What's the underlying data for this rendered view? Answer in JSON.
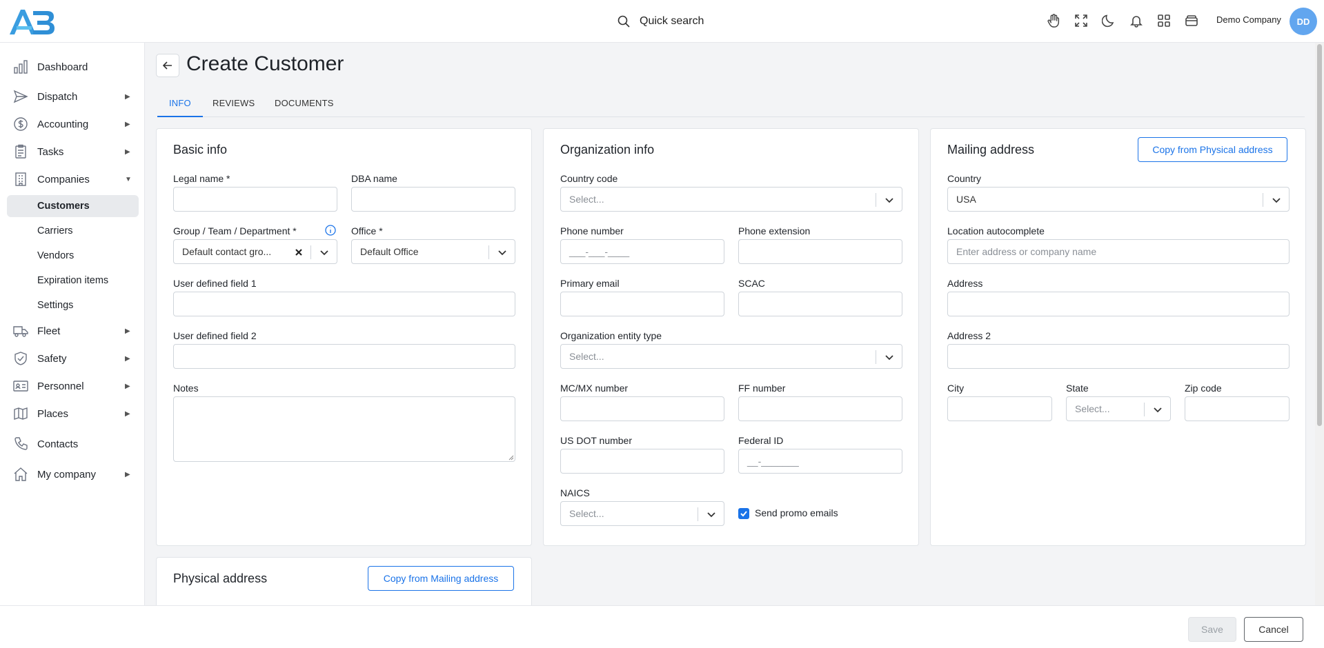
{
  "header": {
    "logo_text": "AB",
    "quick_search": "Quick search",
    "company_name": "Demo Company",
    "avatar_initials": "DD",
    "icons": [
      "hand-icon",
      "fullscreen-icon",
      "moon-icon",
      "bell-icon",
      "apps-grid-icon",
      "wallet-icon"
    ]
  },
  "sidebar": {
    "items": [
      {
        "label": "Dashboard",
        "icon": "bar-chart-icon"
      },
      {
        "label": "Dispatch",
        "icon": "send-icon",
        "arrow": "▶"
      },
      {
        "label": "Accounting",
        "icon": "dollar-icon",
        "arrow": "▶"
      },
      {
        "label": "Tasks",
        "icon": "clipboard-icon",
        "arrow": "▶"
      },
      {
        "label": "Companies",
        "icon": "building-icon",
        "arrow": "▼"
      },
      {
        "label": "Fleet",
        "icon": "truck-icon",
        "arrow": "▶"
      },
      {
        "label": "Safety",
        "icon": "shield-icon",
        "arrow": "▶"
      },
      {
        "label": "Personnel",
        "icon": "id-card-icon",
        "arrow": "▶"
      },
      {
        "label": "Places",
        "icon": "map-icon",
        "arrow": "▶"
      },
      {
        "label": "Contacts",
        "icon": "phone-icon"
      },
      {
        "label": "My company",
        "icon": "home-icon",
        "arrow": "▶"
      }
    ],
    "companies_sub": [
      "Customers",
      "Carriers",
      "Vendors",
      "Expiration items",
      "Settings"
    ]
  },
  "page": {
    "title": "Create Customer",
    "tabs": [
      "INFO",
      "REVIEWS",
      "DOCUMENTS"
    ],
    "active_tab": "INFO"
  },
  "basic_info": {
    "title": "Basic info",
    "legal_name_label": "Legal name *",
    "dba_name_label": "DBA name",
    "group_label": "Group / Team / Department *",
    "group_value": "Default contact gro...",
    "office_label": "Office *",
    "office_value": "Default Office",
    "udf1_label": "User defined field 1",
    "udf2_label": "User defined field 2",
    "notes_label": "Notes"
  },
  "organization_info": {
    "title": "Organization info",
    "country_code_label": "Country code",
    "country_code_placeholder": "Select...",
    "phone_label": "Phone number",
    "phone_placeholder": "___-___-____",
    "phone_ext_label": "Phone extension",
    "email_label": "Primary email",
    "scac_label": "SCAC",
    "entity_type_label": "Organization entity type",
    "entity_type_placeholder": "Select...",
    "mcmx_label": "MC/MX number",
    "ff_label": "FF number",
    "usdot_label": "US DOT number",
    "federal_id_label": "Federal ID",
    "federal_id_placeholder": "__-_______",
    "naics_label": "NAICS",
    "naics_placeholder": "Select...",
    "promo_label": "Send promo emails",
    "promo_checked": true
  },
  "mailing_address": {
    "title": "Mailing address",
    "copy_button": "Copy from Physical address",
    "country_label": "Country",
    "country_value": "USA",
    "location_label": "Location autocomplete",
    "location_placeholder": "Enter address or company name",
    "address_label": "Address",
    "address2_label": "Address 2",
    "city_label": "City",
    "state_label": "State",
    "state_placeholder": "Select...",
    "zip_label": "Zip code"
  },
  "physical_address": {
    "title": "Physical address",
    "copy_button": "Copy from Mailing address"
  },
  "footer": {
    "save": "Save",
    "cancel": "Cancel"
  },
  "colors": {
    "accent": "#1a73e8",
    "avatar": "#62a6ef",
    "logo": "#3a9de0"
  }
}
